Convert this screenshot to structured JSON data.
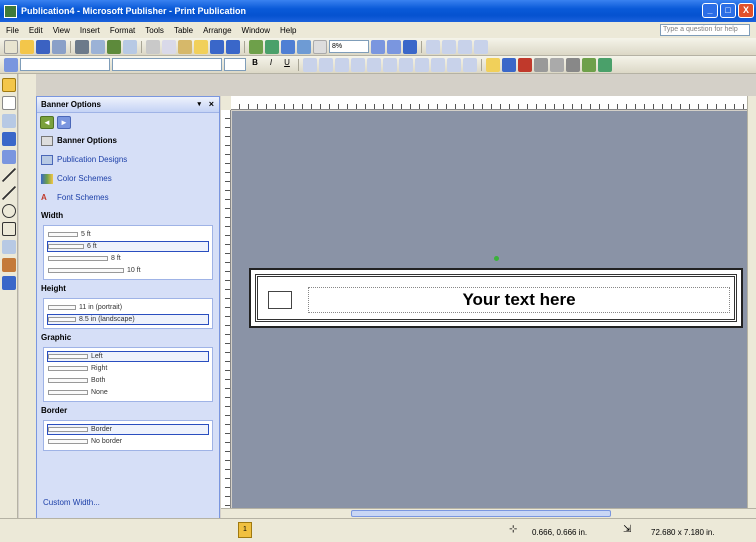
{
  "window": {
    "title": "Publication4 - Microsoft Publisher - Print Publication",
    "minimize": "_",
    "maximize": "□",
    "close": "X"
  },
  "menu": [
    "File",
    "Edit",
    "View",
    "Insert",
    "Format",
    "Tools",
    "Table",
    "Arrange",
    "Window",
    "Help"
  ],
  "help_placeholder": "Type a question for help",
  "toolbar": {
    "zoom": "8%"
  },
  "taskpane": {
    "title": "Banner Options",
    "dropdown": "▾",
    "close": "×",
    "nav_back": "◄",
    "nav_forward": "►",
    "links": [
      {
        "label": "Banner Options",
        "icon": "options-icon"
      },
      {
        "label": "Publication Designs",
        "icon": "designs-icon"
      },
      {
        "label": "Color Schemes",
        "icon": "color-schemes-icon"
      },
      {
        "label": "Font Schemes",
        "icon": "font-schemes-icon"
      }
    ],
    "width": {
      "heading": "Width",
      "options": [
        "5 ft",
        "6 ft",
        "8 ft",
        "10 ft"
      ],
      "selected": "6 ft"
    },
    "height": {
      "heading": "Height",
      "options": [
        "11 in (portrait)",
        "8.5 in (landscape)"
      ],
      "selected": "8.5 in (landscape)"
    },
    "graphic": {
      "heading": "Graphic",
      "options": [
        "Left",
        "Right",
        "Both",
        "None"
      ],
      "selected": "Left"
    },
    "border": {
      "heading": "Border",
      "options": [
        "Border",
        "No border"
      ],
      "selected": "Border"
    },
    "custom_width": "Custom Width..."
  },
  "document": {
    "banner_text": "Your text here"
  },
  "status": {
    "page": "1",
    "position": "0.666, 0.666 in.",
    "size": "72.680 x 7.180 in."
  }
}
